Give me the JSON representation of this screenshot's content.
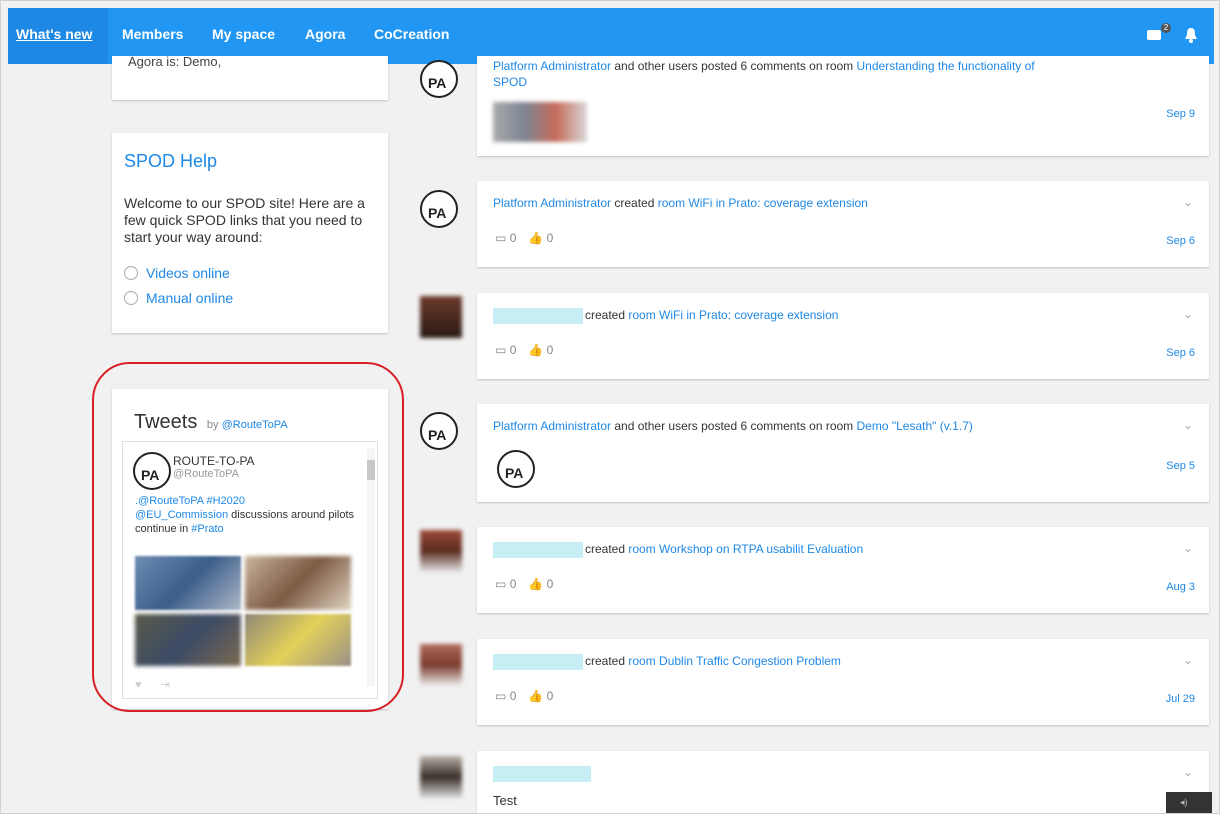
{
  "nav": {
    "items": [
      "What's new",
      "Members",
      "My space",
      "Agora",
      "CoCreation"
    ],
    "notification_count": "2"
  },
  "left": {
    "top_card_cut": "Agora is: Demo,",
    "help": {
      "title": "SPOD Help",
      "text": "Welcome to our SPOD site! Here are a few quick SPOD links that you need to start your way around:",
      "links": [
        "Videos online",
        "Manual online"
      ]
    },
    "tweets": {
      "title": "Tweets",
      "by": "by",
      "handle_link": "@RouteToPA",
      "account_name": "ROUTE-TO-PA",
      "account_handle": "@RouteToPA",
      "text_parts": [
        ".@RouteToPA #H2020",
        "@EU_Commission",
        " discussions around pilots continue in ",
        "#Prato"
      ]
    }
  },
  "feed": [
    {
      "actor": "Platform Administrator",
      "text": " and other users posted 6 comments on room ",
      "link": "Understanding the functionality of SPOD",
      "date": "Sep 9"
    },
    {
      "actor": "Platform Administrator",
      "text": " created ",
      "link": "room WiFi in Prato: coverage extension",
      "likes": "0",
      "comments": "0",
      "date": "Sep 6"
    },
    {
      "actor": "",
      "text": "created ",
      "link": "room WiFi in Prato: coverage extension",
      "likes": "0",
      "comments": "0",
      "date": "Sep 6"
    },
    {
      "actor": "Platform Administrator",
      "text": " and other users posted 6 comments on room ",
      "link": "Demo \"Lesath\" (v.1.7)",
      "date": "Sep 5"
    },
    {
      "actor": "",
      "text": "created ",
      "link": "room Workshop on RTPA usabilit Evaluation",
      "likes": "0",
      "comments": "0",
      "date": "Aug 3"
    },
    {
      "actor": "",
      "text": "created ",
      "link": "room Dublin Traffic Congestion Problem",
      "likes": "0",
      "comments": "0",
      "date": "Jul 29"
    },
    {
      "actor": "",
      "text": "",
      "link": "",
      "body": "Test"
    }
  ],
  "logo_text": "PA",
  "colors": {
    "nav": "#2196f3",
    "link": "#1e88e5",
    "highlight": "#d71e24"
  }
}
